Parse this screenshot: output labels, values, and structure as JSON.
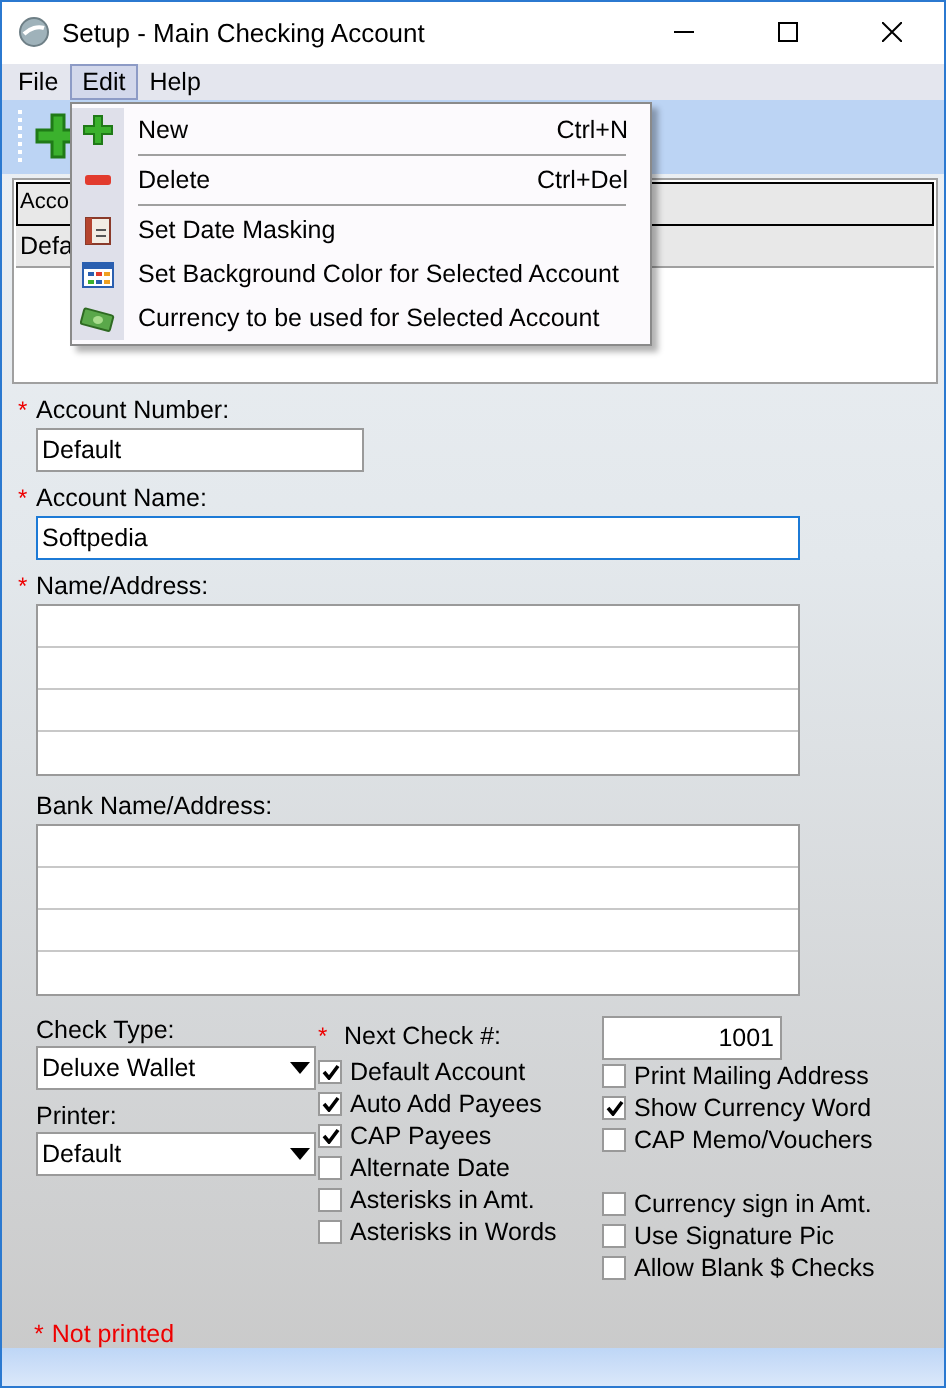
{
  "window": {
    "title": "Setup - Main Checking Account"
  },
  "menu_bar": [
    {
      "label": "File",
      "selected": false
    },
    {
      "label": "Edit",
      "selected": true
    },
    {
      "label": "Help",
      "selected": false
    }
  ],
  "edit_menu": {
    "items": [
      {
        "kind": "add",
        "label": "New",
        "shortcut": "Ctrl+N"
      },
      {
        "kind": "remove",
        "label": "Delete",
        "shortcut": "Ctrl+Del"
      },
      {
        "kind": "calendar",
        "label": "Set Date Masking"
      },
      {
        "kind": "palette",
        "label": "Set Background Color for Selected Account"
      },
      {
        "kind": "money",
        "label": "Currency to be used for Selected Account"
      }
    ]
  },
  "accounts_table": {
    "column_1": "Acco",
    "rows": [
      "Defa"
    ]
  },
  "fields": [
    {
      "kind": "line",
      "label": "Account Number:",
      "required": true,
      "value": "Default",
      "focused": false,
      "wide": false
    },
    {
      "kind": "line",
      "label": "Account Name:",
      "required": true,
      "value": "Softpedia",
      "focused": true,
      "wide": true
    },
    {
      "kind": "multi",
      "label": "Name/Address:",
      "required": true
    },
    {
      "kind": "multi",
      "label": "Bank Name/Address:",
      "required": false
    }
  ],
  "check_type": {
    "label": "Check Type:",
    "value": "Deluxe Wallet"
  },
  "printer": {
    "label": "Printer:",
    "value": "Default"
  },
  "next_check": {
    "label": "Next Check #:",
    "required": true,
    "value": "1001"
  },
  "options_middle": [
    {
      "label": "Default Account",
      "checked": true
    },
    {
      "label": "Auto Add Payees",
      "checked": true
    },
    {
      "label": "CAP Payees",
      "checked": true
    },
    {
      "label": "Alternate Date",
      "checked": false
    },
    {
      "label": "Asterisks in Amt.",
      "checked": false
    },
    {
      "label": "Asterisks in Words",
      "checked": false
    }
  ],
  "options_right": [
    [
      {
        "label": "Print Mailing Address",
        "checked": false
      },
      {
        "label": "Show Currency Word",
        "checked": true
      },
      {
        "label": "CAP Memo/Vouchers",
        "checked": false
      }
    ],
    [
      {
        "label": "Currency sign in Amt.",
        "checked": false
      },
      {
        "label": "Use Signature Pic",
        "checked": false
      },
      {
        "label": "Allow Blank $ Checks",
        "checked": false
      }
    ]
  ],
  "legend": {
    "mark": "*",
    "text": "Not printed"
  }
}
